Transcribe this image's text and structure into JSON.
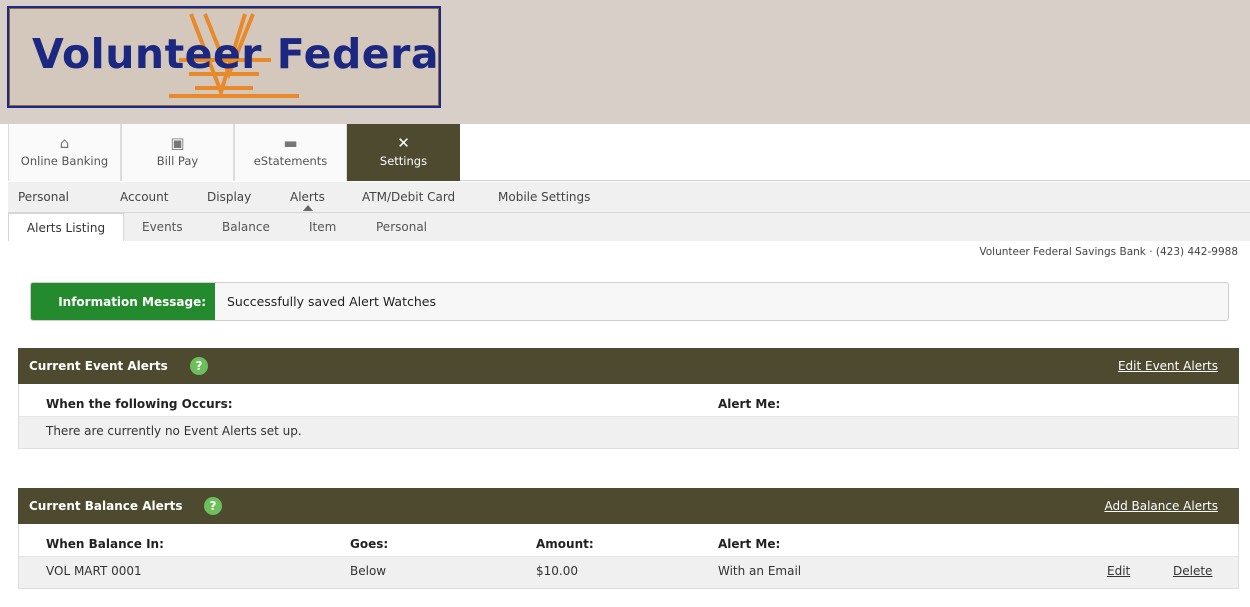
{
  "logo": {
    "text": "Volunteer Federal",
    "colors": {
      "navy": "#1b2780",
      "orange": "#e8892a",
      "beige": "#d4c8bc"
    }
  },
  "topnav": [
    {
      "label": "Online Banking",
      "icon": "home-icon"
    },
    {
      "label": "Bill Pay",
      "icon": "bill-pay-icon"
    },
    {
      "label": "eStatements",
      "icon": "briefcase-icon"
    },
    {
      "label": "Settings",
      "icon": "tools-icon",
      "active": true
    }
  ],
  "subnav": [
    "Personal",
    "Account",
    "Display",
    "Alerts",
    "ATM/Debit Card",
    "Mobile Settings"
  ],
  "subnav_active": "Alerts",
  "subnav2": [
    "Alerts Listing",
    "Events",
    "Balance",
    "Item",
    "Personal"
  ],
  "subnav2_active": "Alerts Listing",
  "bank_info": "Volunteer Federal Savings Bank · (423) 442-9988",
  "info_message": {
    "label": "Information Message:",
    "text": "Successfully saved Alert Watches"
  },
  "event_alerts": {
    "title": "Current Event Alerts",
    "link": "Edit Event Alerts",
    "columns": [
      "When the following Occurs:",
      "Alert Me:"
    ],
    "empty_text": "There are currently no Event Alerts set up."
  },
  "balance_alerts": {
    "title": "Current Balance Alerts",
    "link": "Add Balance Alerts",
    "columns": [
      "When Balance In:",
      "Goes:",
      "Amount:",
      "Alert Me:"
    ],
    "rows": [
      {
        "account": "VOL MART 0001",
        "goes": "Below",
        "amount": "$10.00",
        "alert": "With an Email",
        "edit": "Edit",
        "delete": "Delete"
      }
    ]
  },
  "colors": {
    "header_bg": "#d8cfc8",
    "panel_header": "#4d4a30",
    "info_green": "#238a2d",
    "help_green": "#6cbf5a"
  }
}
